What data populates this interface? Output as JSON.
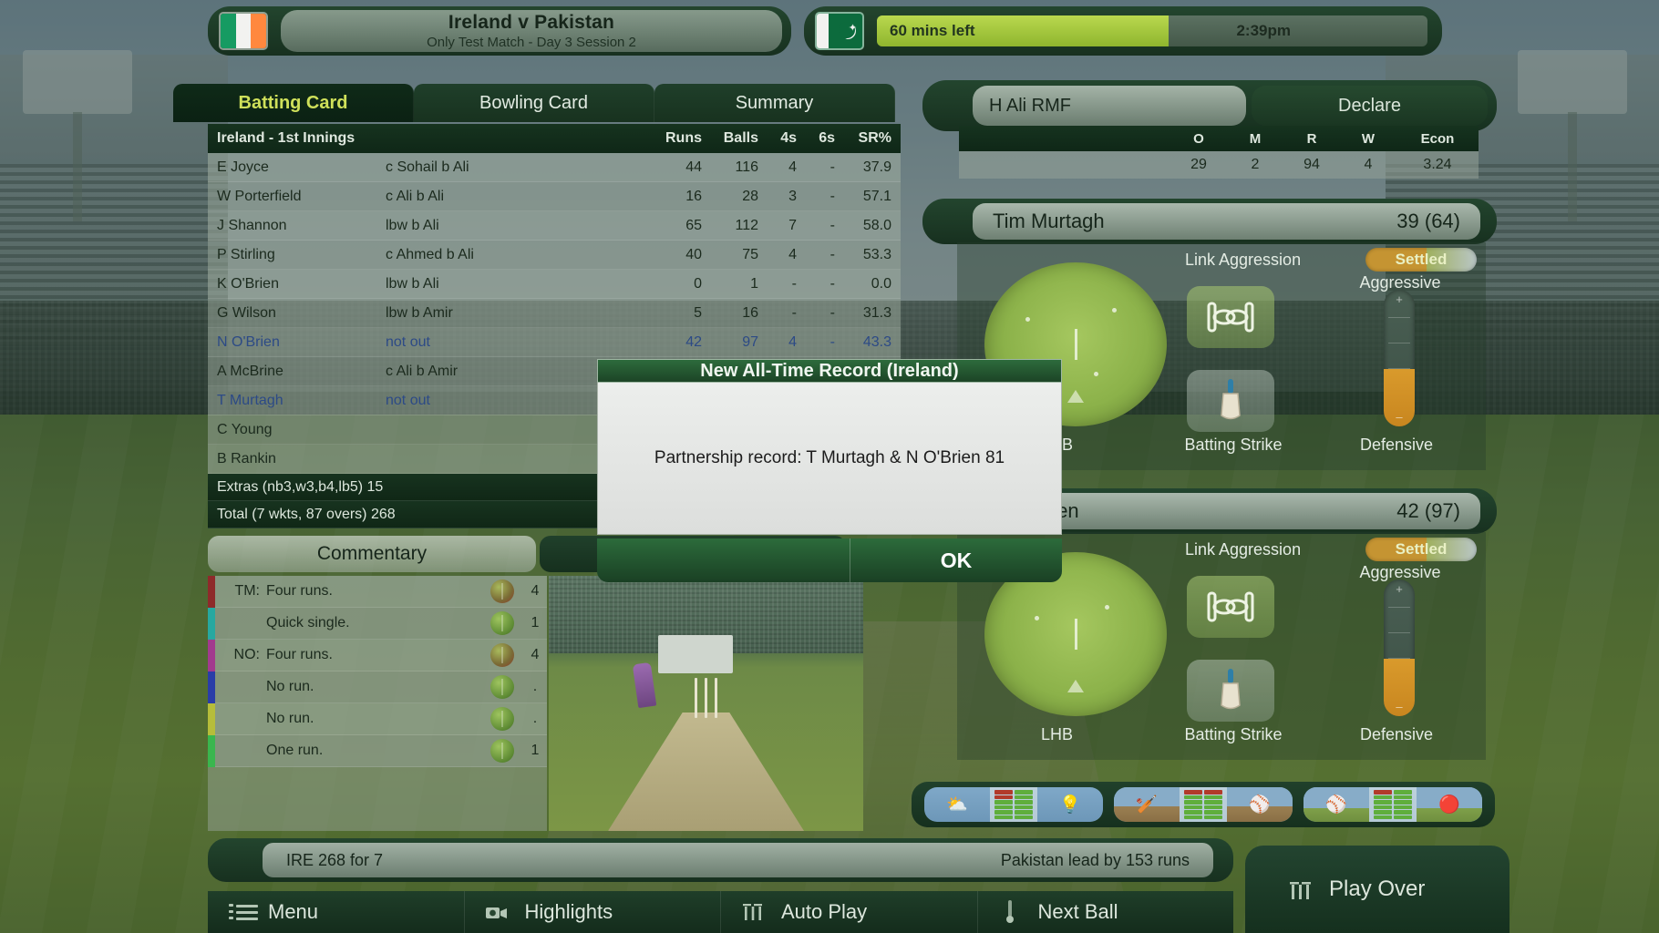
{
  "header": {
    "match_title": "Ireland v Pakistan",
    "match_subtitle": "Only Test Match - Day 3 Session 2",
    "home_flag": "ireland-flag",
    "away_flag": "pakistan-flag",
    "timer_label": "60 mins left",
    "clock": "2:39pm",
    "timer_percent": 53
  },
  "tabs": [
    {
      "label": "Batting Card",
      "active": true
    },
    {
      "label": "Bowling Card",
      "active": false
    },
    {
      "label": "Summary",
      "active": false
    }
  ],
  "batting_card": {
    "innings_title": "Ireland - 1st Innings",
    "columns": {
      "runs": "Runs",
      "balls": "Balls",
      "fours": "4s",
      "sixes": "6s",
      "sr": "SR%"
    },
    "rows": [
      {
        "name": "E Joyce",
        "how_out": "c Sohail b Ali",
        "runs": "44",
        "balls": "116",
        "fours": "4",
        "sixes": "-",
        "sr": "37.9",
        "not_out": false
      },
      {
        "name": "W Porterfield",
        "how_out": "c Ali b Ali",
        "runs": "16",
        "balls": "28",
        "fours": "3",
        "sixes": "-",
        "sr": "57.1",
        "not_out": false
      },
      {
        "name": "J Shannon",
        "how_out": "lbw b Ali",
        "runs": "65",
        "balls": "112",
        "fours": "7",
        "sixes": "-",
        "sr": "58.0",
        "not_out": false
      },
      {
        "name": "P Stirling",
        "how_out": "c Ahmed b Ali",
        "runs": "40",
        "balls": "75",
        "fours": "4",
        "sixes": "-",
        "sr": "53.3",
        "not_out": false
      },
      {
        "name": "K O'Brien",
        "how_out": "lbw b Ali",
        "runs": "0",
        "balls": "1",
        "fours": "-",
        "sixes": "-",
        "sr": "0.0",
        "not_out": false
      },
      {
        "name": "G Wilson",
        "how_out": "lbw b Amir",
        "runs": "5",
        "balls": "16",
        "fours": "-",
        "sixes": "-",
        "sr": "31.3",
        "not_out": false
      },
      {
        "name": "N O'Brien",
        "how_out": "not out",
        "runs": "42",
        "balls": "97",
        "fours": "4",
        "sixes": "-",
        "sr": "43.3",
        "not_out": true
      },
      {
        "name": "A McBrine",
        "how_out": "c Ali b Amir",
        "runs": "",
        "balls": "",
        "fours": "",
        "sixes": "",
        "sr": "",
        "not_out": false
      },
      {
        "name": "T Murtagh",
        "how_out": "not out",
        "runs": "",
        "balls": "",
        "fours": "",
        "sixes": "",
        "sr": "",
        "not_out": true
      },
      {
        "name": "C Young",
        "how_out": "",
        "runs": "",
        "balls": "",
        "fours": "",
        "sixes": "",
        "sr": "",
        "not_out": false
      },
      {
        "name": "B Rankin",
        "how_out": "",
        "runs": "",
        "balls": "",
        "fours": "",
        "sixes": "",
        "sr": "",
        "not_out": false
      }
    ],
    "extras": "Extras (nb3,w3,b4,lb5) 15",
    "total": "Total (7 wkts, 87 overs) 268"
  },
  "commentary": {
    "tab_label": "Commentary",
    "rows": [
      {
        "batsman": "TM:",
        "text": "Four runs.",
        "runs": "4",
        "marker": "#8e2a2a",
        "ball": "red"
      },
      {
        "batsman": "",
        "text": "Quick single.",
        "runs": "1",
        "marker": "#27a8a0",
        "ball": "green"
      },
      {
        "batsman": "NO:",
        "text": "Four runs.",
        "runs": "4",
        "marker": "#a23a8e",
        "ball": "red"
      },
      {
        "batsman": "",
        "text": "No run.",
        "runs": ".",
        "marker": "#2a3da8",
        "ball": "green"
      },
      {
        "batsman": "",
        "text": "No run.",
        "runs": ".",
        "marker": "#b6bd3a",
        "ball": "green"
      },
      {
        "batsman": "",
        "text": "One run.",
        "runs": "1",
        "marker": "#3ab64e",
        "ball": "green"
      }
    ]
  },
  "bowler": {
    "name": "H Ali RMF",
    "declare_label": "Declare",
    "columns": {
      "overs": "O",
      "maidens": "M",
      "runs": "R",
      "wickets": "W",
      "econ": "Econ"
    },
    "stats": {
      "overs": "29",
      "maidens": "2",
      "runs": "94",
      "wickets": "4",
      "econ": "3.24"
    }
  },
  "batsmen": [
    {
      "name": "Tim Murtagh",
      "score": "39 (64)",
      "link_label": "Link Aggression",
      "chip_label": "Settled",
      "aggressive_label": "Aggressive",
      "hand_label": "LHB",
      "strike_label": "Batting Strike",
      "defensive_label": "Defensive",
      "link_icon": "chain-link-icon",
      "bat_icon": "cricket-bat-icon",
      "slider_value": 42
    },
    {
      "name": "N O'Brien",
      "score": "42 (97)",
      "link_label": "Link Aggression",
      "chip_label": "Settled",
      "aggressive_label": "Aggressive",
      "hand_label": "LHB",
      "strike_label": "Batting Strike",
      "defensive_label": "Defensive",
      "link_icon": "chain-link-icon",
      "bat_icon": "cricket-bat-icon",
      "slider_value": 42
    }
  ],
  "conditions": [
    {
      "name": "weather-conditions",
      "left_icon": "sun-cloud-icon",
      "right_icon": "lightbulb-icon"
    },
    {
      "name": "pitch-bounce-conditions",
      "left_icon": "ball-bounce-icon",
      "right_icon": "ball-seam-icon"
    },
    {
      "name": "pitch-wear-conditions",
      "left_icon": "ball-swing-icon",
      "right_icon": "ball-worn-icon"
    }
  ],
  "scorebar": {
    "score": "IRE  268 for 7",
    "situation": "Pakistan lead by 153 runs"
  },
  "play_over": {
    "label": "Play Over",
    "icon": "stumps-icon"
  },
  "nav": [
    {
      "label": "Menu",
      "icon": "list-icon"
    },
    {
      "label": "Highlights",
      "icon": "camera-icon"
    },
    {
      "label": "Auto Play",
      "icon": "stumps-icon"
    },
    {
      "label": "Next Ball",
      "icon": "ball-trail-icon"
    }
  ],
  "modal": {
    "title": "New All-Time Record (Ireland)",
    "message": "Partnership record: T Murtagh & N O'Brien  81",
    "ok_label": "OK"
  }
}
